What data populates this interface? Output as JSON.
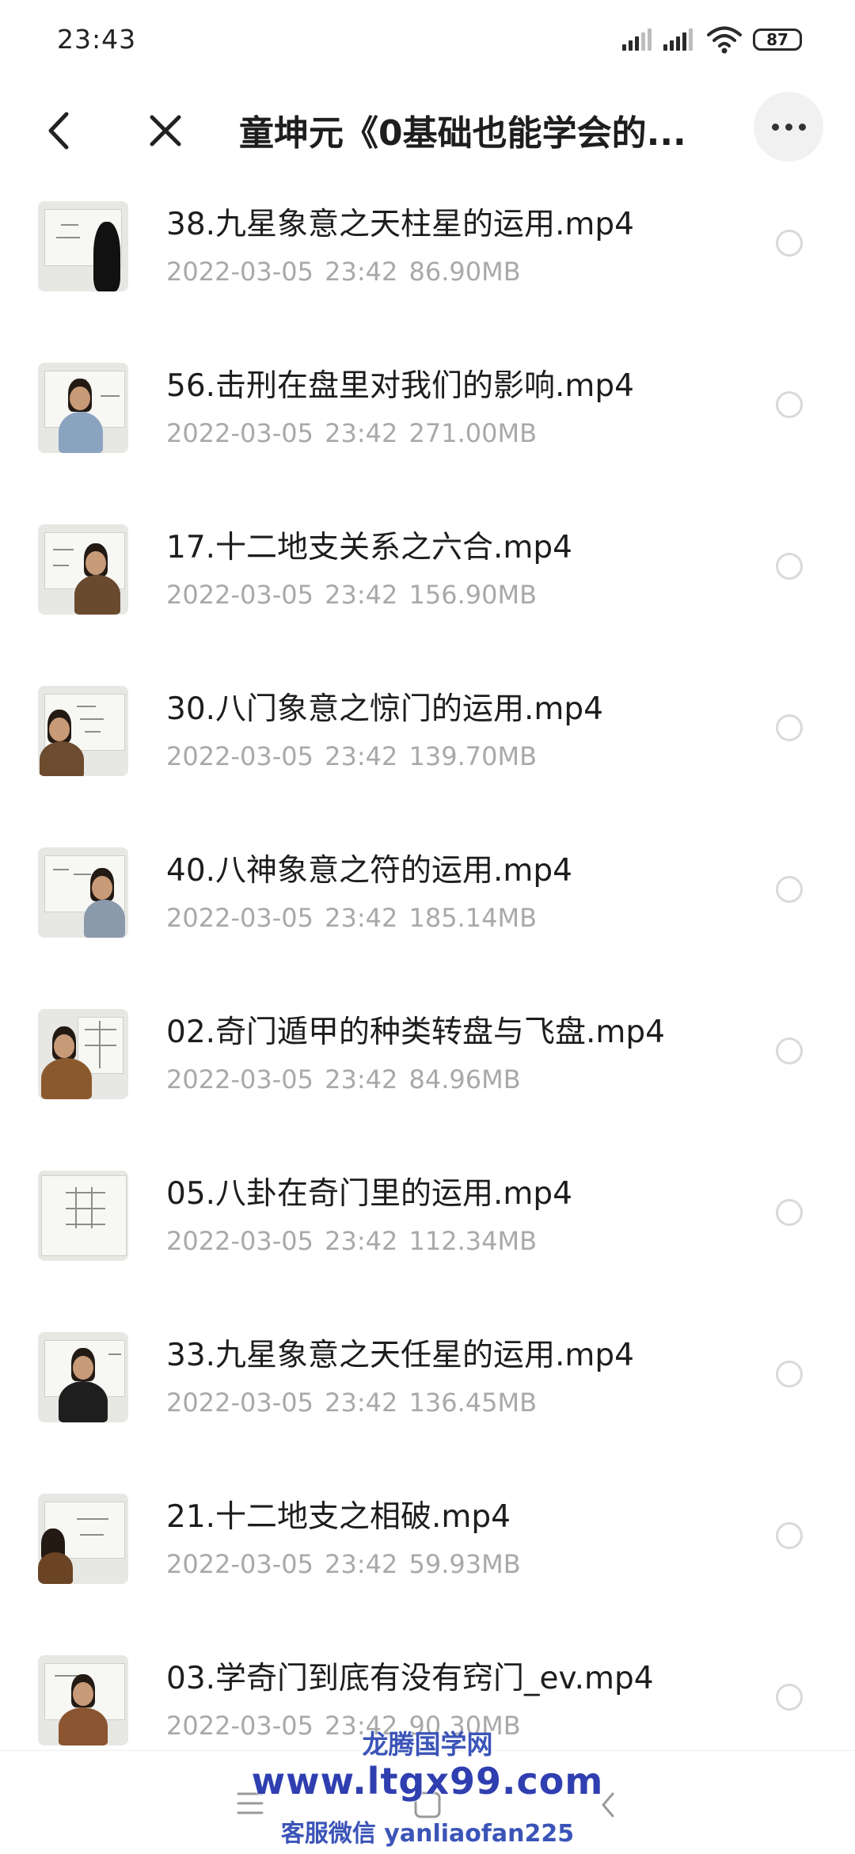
{
  "status_bar": {
    "time": "23:43",
    "battery": "87"
  },
  "header": {
    "title": "童坤元《0基础也能学会的...",
    "back_icon": "back-arrow-icon",
    "close_icon": "close-icon",
    "more_icon": "more-icon"
  },
  "files": [
    {
      "name": "38.九星象意之天柱星的运用.mp4",
      "date": "2022-03-05",
      "time": "23:42",
      "size": "86.90MB"
    },
    {
      "name": "56.击刑在盘里对我们的影响.mp4",
      "date": "2022-03-05",
      "time": "23:42",
      "size": "271.00MB"
    },
    {
      "name": "17.十二地支关系之六合.mp4",
      "date": "2022-03-05",
      "time": "23:42",
      "size": "156.90MB"
    },
    {
      "name": "30.八门象意之惊门的运用.mp4",
      "date": "2022-03-05",
      "time": "23:42",
      "size": "139.70MB"
    },
    {
      "name": "40.八神象意之符的运用.mp4",
      "date": "2022-03-05",
      "time": "23:42",
      "size": "185.14MB"
    },
    {
      "name": "02.奇门遁甲的种类转盘与飞盘.mp4",
      "date": "2022-03-05",
      "time": "23:42",
      "size": "84.96MB"
    },
    {
      "name": "05.八卦在奇门里的运用.mp4",
      "date": "2022-03-05",
      "time": "23:42",
      "size": "112.34MB"
    },
    {
      "name": "33.九星象意之天任星的运用.mp4",
      "date": "2022-03-05",
      "time": "23:42",
      "size": "136.45MB"
    },
    {
      "name": "21.十二地支之相破.mp4",
      "date": "2022-03-05",
      "time": "23:42",
      "size": "59.93MB"
    },
    {
      "name": "03.学奇门到底有没有窍门_ev.mp4",
      "date": "2022-03-05",
      "time": "23:42",
      "size": "90.30MB"
    }
  ],
  "bottom_nav": {
    "icons": [
      "menu-icon",
      "home-square-icon",
      "back-chevron-icon"
    ]
  },
  "watermark": {
    "line1": "龙腾国学网",
    "line2": "www.ltgx99.com",
    "line3": "客服微信 yanliaofan225"
  }
}
